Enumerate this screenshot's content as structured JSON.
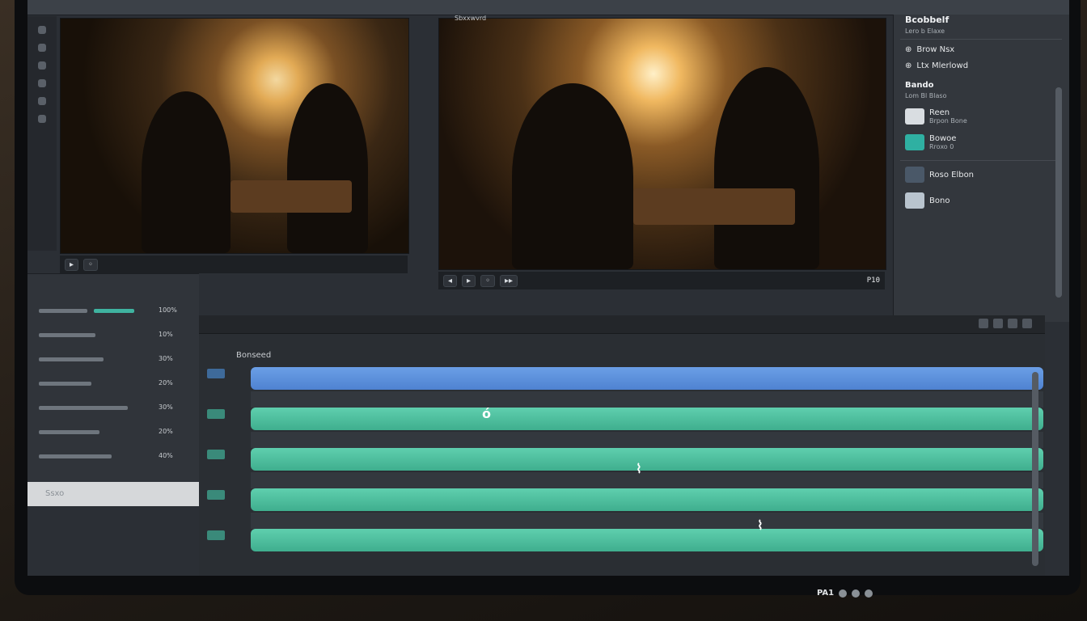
{
  "right_panel": {
    "title": "Bcobbelf",
    "subtitle": "Lero b Elaxe",
    "actions": [
      {
        "icon": "plus-icon",
        "label": "Brow Nsx"
      },
      {
        "icon": "plus-icon",
        "label": "Ltx Mlerlowd"
      }
    ],
    "section_title": "Bando",
    "section_sub": "Lom Bl Blaso",
    "media_items": [
      {
        "label": "Reen",
        "sub": "Brpon Bone",
        "thumb_color": "#d9dde1"
      },
      {
        "label": "Bowoe",
        "sub": "Rroxo 0",
        "thumb_color": "#2fb0a2"
      },
      {
        "label": "Roso Elbon",
        "sub": "",
        "thumb_color": "#4a5868"
      },
      {
        "label": "Bono",
        "sub": "",
        "thumb_color": "#b9c4ce"
      }
    ]
  },
  "viewer_right": {
    "header": "Sbxxwvrd",
    "timecode": "P10",
    "transport": [
      "◂",
      "▸",
      "◦",
      "▸▸"
    ]
  },
  "left_panel": {
    "rows": [
      {
        "value": "100%"
      },
      {
        "value": "10%"
      },
      {
        "value": "30%"
      },
      {
        "value": "20%"
      },
      {
        "value": "30%"
      },
      {
        "value": "20%"
      },
      {
        "value": "40%"
      }
    ],
    "search_placeholder": "Ssxo"
  },
  "timeline": {
    "sequence_label": "Bonseed",
    "tracks": [
      {
        "type": "video",
        "color": "#5b8fdc"
      },
      {
        "type": "audio",
        "color": "#4cbf9c"
      },
      {
        "type": "audio",
        "color": "#4cbf9c"
      },
      {
        "type": "audio",
        "color": "#4cbf9c"
      },
      {
        "type": "audio",
        "color": "#4cbf9c"
      }
    ],
    "markers": [
      "ó",
      "⌇",
      "⌇"
    ]
  },
  "status": {
    "label": "PA1"
  }
}
